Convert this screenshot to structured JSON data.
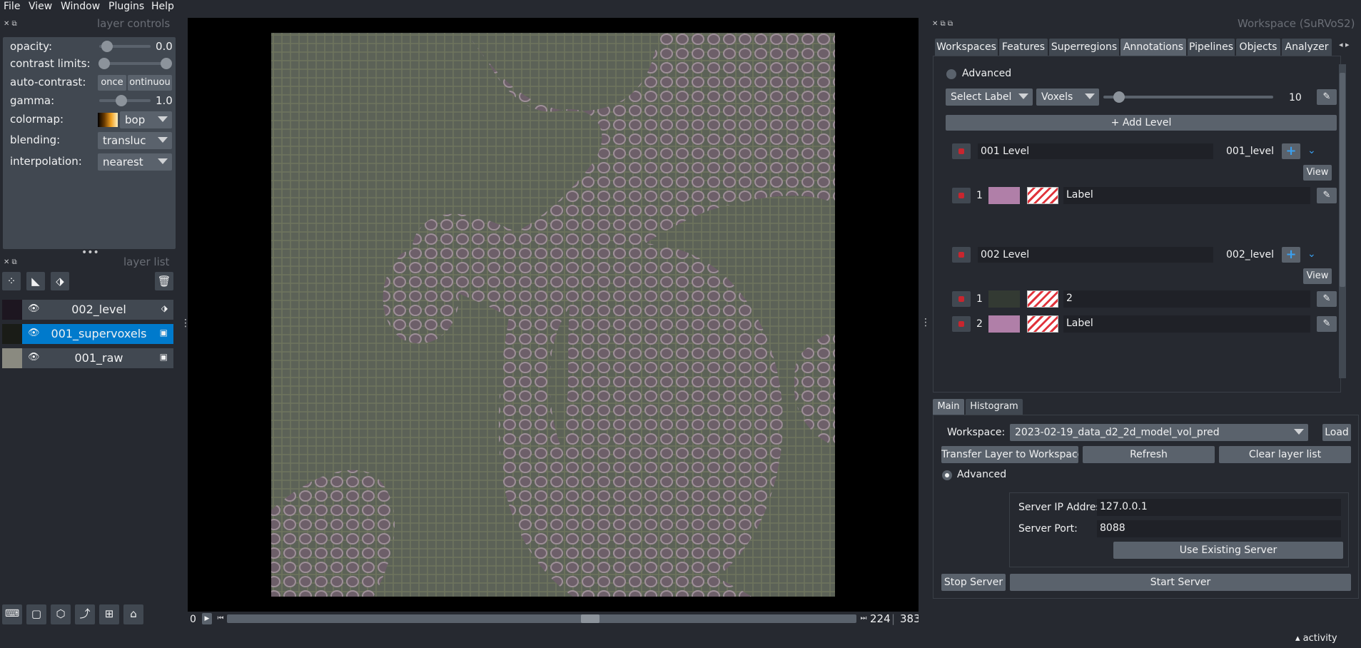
{
  "menu": {
    "file": "File",
    "view": "View",
    "window": "Window",
    "plugins": "Plugins",
    "help": "Help"
  },
  "layer_controls": {
    "title": "layer controls",
    "opacity_label": "opacity:",
    "opacity_value": "0.0",
    "contrast_label": "contrast limits:",
    "autocontrast_label": "auto-contrast:",
    "once_label": "once",
    "continuous_label": "ontinuou",
    "gamma_label": "gamma:",
    "gamma_value": "1.0",
    "colormap_label": "colormap:",
    "colormap_value": "bop",
    "blending_label": "blending:",
    "blending_value": "transluc",
    "interpolation_label": "interpolation:",
    "interpolation_value": "nearest"
  },
  "layer_list": {
    "title": "layer list",
    "layers": [
      {
        "name": "002_level",
        "type": "labels",
        "selected": false
      },
      {
        "name": "001_supervoxels",
        "type": "image",
        "selected": true
      },
      {
        "name": "001_raw",
        "type": "image",
        "selected": false
      }
    ]
  },
  "viewer": {
    "frame_start": "0",
    "frame_value": "224",
    "frame_total": "383",
    "slider_position": 0.58
  },
  "workspace": {
    "title": "Workspace (SuRVoS2)",
    "tabs": [
      "Workspaces",
      "Features",
      "Superregions",
      "Annotations",
      "Pipelines",
      "Objects",
      "Analyzer"
    ],
    "active_tab": "Annotations",
    "annotations": {
      "advanced_label": "Advanced",
      "select_label": "Select Label",
      "voxels_label": "Voxels",
      "brush_value": "10",
      "add_level_label": "+ Add Level",
      "levels": [
        {
          "name": "001 Level",
          "id": "001_level",
          "view_label": "View",
          "labels": [
            {
              "index": "1",
              "color": "#b07fa8",
              "name": "Label"
            }
          ]
        },
        {
          "name": "002 Level",
          "id": "002_level",
          "view_label": "View",
          "labels": [
            {
              "index": "1",
              "color": "#333a33",
              "name": "2"
            },
            {
              "index": "2",
              "color": "#b07fa8",
              "name": "Label"
            }
          ]
        }
      ]
    },
    "bottom_tabs": [
      "Main",
      "Histogram"
    ],
    "main": {
      "workspace_label": "Workspace:",
      "workspace_value": "2023-02-19_data_d2_2d_model_vol_pred",
      "load_label": "Load",
      "transfer_label": "Transfer Layer to Workspace",
      "refresh_label": "Refresh",
      "clear_label": "Clear layer list",
      "advanced_label": "Advanced",
      "server_ip_label": "Server IP Address:",
      "server_ip_value": "127.0.0.1",
      "server_port_label": "Server Port:",
      "server_port_value": "8088",
      "use_existing_label": "Use Existing Server",
      "stop_label": "Stop Server",
      "start_label": "Start Server"
    }
  },
  "status": {
    "activity_label": "activity"
  }
}
